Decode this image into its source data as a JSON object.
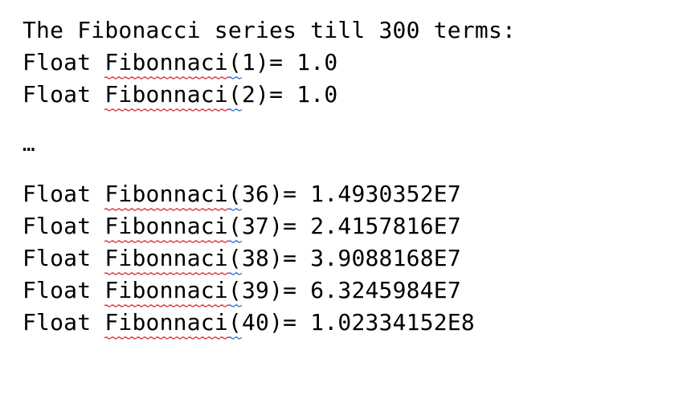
{
  "heading_prefix": "The Fibonacci series till ",
  "heading_num": "300",
  "heading_suffix": " terms:",
  "float_label": "Float ",
  "fib_word": "Fibonnaci",
  "eq": ")= ",
  "block1": [
    {
      "open": "(",
      "idx": "1",
      "val": "1.0"
    },
    {
      "open": "(",
      "idx": "2",
      "val": "1.0"
    }
  ],
  "ellipsis": "…",
  "block2": [
    {
      "open": "(",
      "idx": "36",
      "val": "1.4930352E7"
    },
    {
      "open": "(",
      "idx": "37",
      "val": "2.4157816E7"
    },
    {
      "open": "(",
      "idx": "38",
      "val": "3.9088168E7"
    },
    {
      "open": "(",
      "idx": "39",
      "val": "6.3245984E7"
    },
    {
      "open": "(",
      "idx": "40",
      "val": "1.02334152E8"
    }
  ]
}
